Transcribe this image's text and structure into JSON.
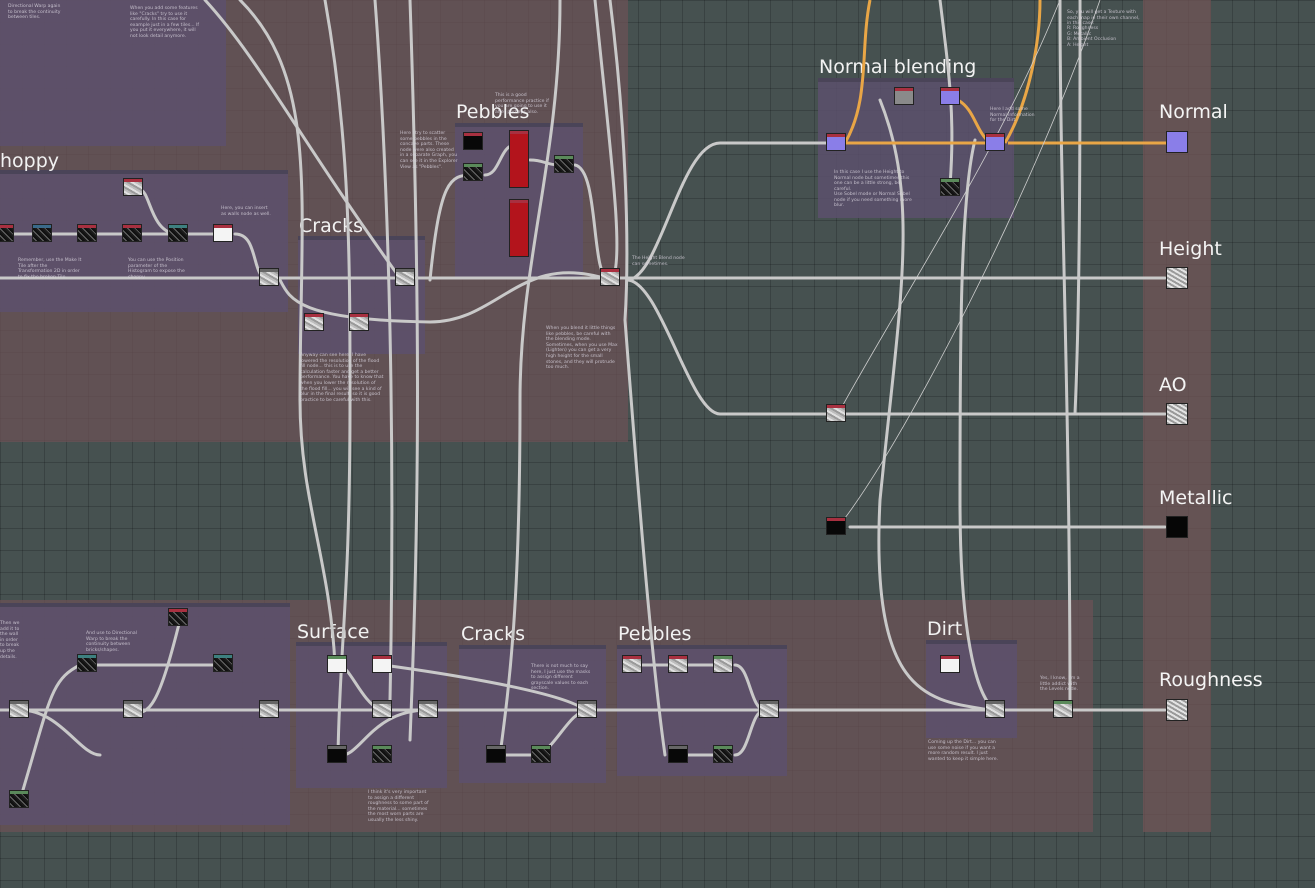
{
  "groups": {
    "choppy": "hoppy",
    "cracks_top": "Cracks",
    "pebbles_top": "Pebbles",
    "normal_blending": "Normal blending",
    "surface": "Surface",
    "cracks_bottom": "Cracks",
    "pebbles_bottom": "Pebbles",
    "dirt": "Dirt"
  },
  "outputs": {
    "normal": "Normal",
    "height": "Height",
    "ao": "AO",
    "metallic": "Metallic",
    "roughness": "Roughness"
  },
  "notes": {
    "tl1": "Directional Warp again to break the continuity between tiles.",
    "tl2": "When you add some features like \"Cracks\" try to use it carefully. In this case for example just in a few tiles... If you put it everywhere, it will not look detail anymore.",
    "choppy1": "Here, you can insert as walls node as well.",
    "choppy2": "Remember, use the Make It Tile after the Transformation 2D in order to fix the broken Tile.",
    "choppy3": "You can use the Position parameter of the Histogram to expose the choppy.",
    "pebbles1": "Here I try to scatter some pebbles in the concave parts. These node were also created in a separate Graph, you can see it in the Explorer View as \"Pebbles\".",
    "pebbles2": "This is a good performance practice if you are going to use it after perhaps also.",
    "cracks1": "Anyway can see here, I have lowered the resolution of the flood fill node... this is to use the calculation faster and get a better performance. You have to know that when you lower the resolution of the flood fill... you will see a kind of blur in the final result, so it is good practice to be careful with this.",
    "blend1": "The Height Blend node can sometimes.",
    "blend2": "When you blend it little things like pebbles, be careful with the blending mode. Sometimes, when you use Max (Lighten) you can get a very high height for the small stones, and they will protrude too much.",
    "normal1": "In this case I use the Height to Normal node but sometimes this one can be a little strong, be careful.",
    "normal2": "Use Sobel mode or Normal Sobel node if you need something more blur.",
    "normal3": "Here I add some Normal information for the Dirt.",
    "tr1": "So, you will get a Texture with each map in their own channel, in this case:",
    "tr2": "R: Roughness\nG: Metallic\nB: Ambient Occlusion\nA: Height",
    "bl1": "Then we add it to the wall in order to break up the details.",
    "bl2": "And use to Directional Warp to break the continuity between bricks/shapes.",
    "surface1": "I think it's very important to assign a different roughness to some part of the material... sometimes the most worn parts are usually the less shiny.",
    "cracks2": "There is not much to say here, I just use the masks to assign different grayscale values to each section.",
    "dirt1": "Coming up the Dirt... you can use some noise if you want a more random result. I just wanted to keep it simple here.",
    "dirt2": "Yes, I know, I'm a little addict with the Levels node."
  }
}
